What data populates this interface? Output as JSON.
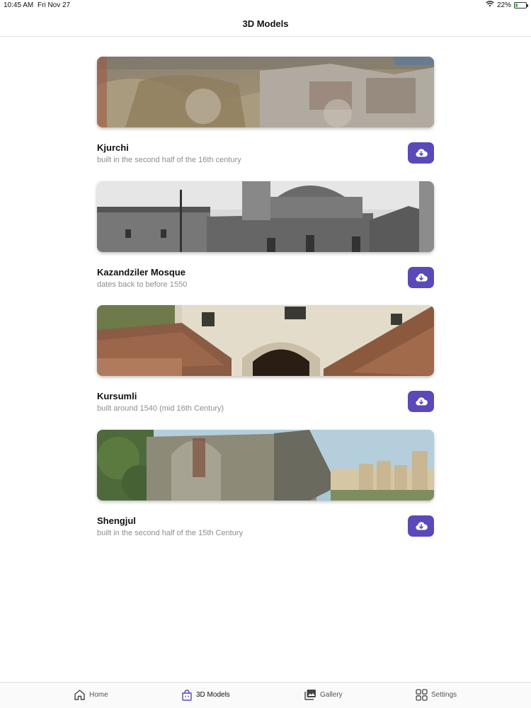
{
  "status_bar": {
    "time": "10:45 AM",
    "date": "Fri Nov 27",
    "battery_percent": "22%",
    "battery_level": 0.22,
    "wifi_icon": "wifi-icon",
    "battery_icon": "battery-charging-icon"
  },
  "header": {
    "title": "3D Models"
  },
  "models": [
    {
      "title": "Kjurchi",
      "subtitle": "built in the second half of the 16th century",
      "button_icon": "cloud-download-icon"
    },
    {
      "title": "Kazandziler Mosque",
      "subtitle": "dates back to before 1550",
      "button_icon": "cloud-download-icon"
    },
    {
      "title": "Kursumli",
      "subtitle": "built around 1540 (mid 16th Century)",
      "button_icon": "cloud-download-icon"
    },
    {
      "title": "Shengjul",
      "subtitle": "built in the second half of the 15th Century",
      "button_icon": "cloud-download-icon"
    }
  ],
  "tabs": [
    {
      "label": "Home",
      "icon": "home-icon",
      "active": false
    },
    {
      "label": "3D Models",
      "icon": "cube-bag-icon",
      "active": true
    },
    {
      "label": "Gallery",
      "icon": "gallery-icon",
      "active": false
    },
    {
      "label": "Settings",
      "icon": "grid-icon",
      "active": false
    }
  ],
  "colors": {
    "accent": "#5a49b8",
    "subtitle": "#8e8e93",
    "background": "#ffffff"
  }
}
